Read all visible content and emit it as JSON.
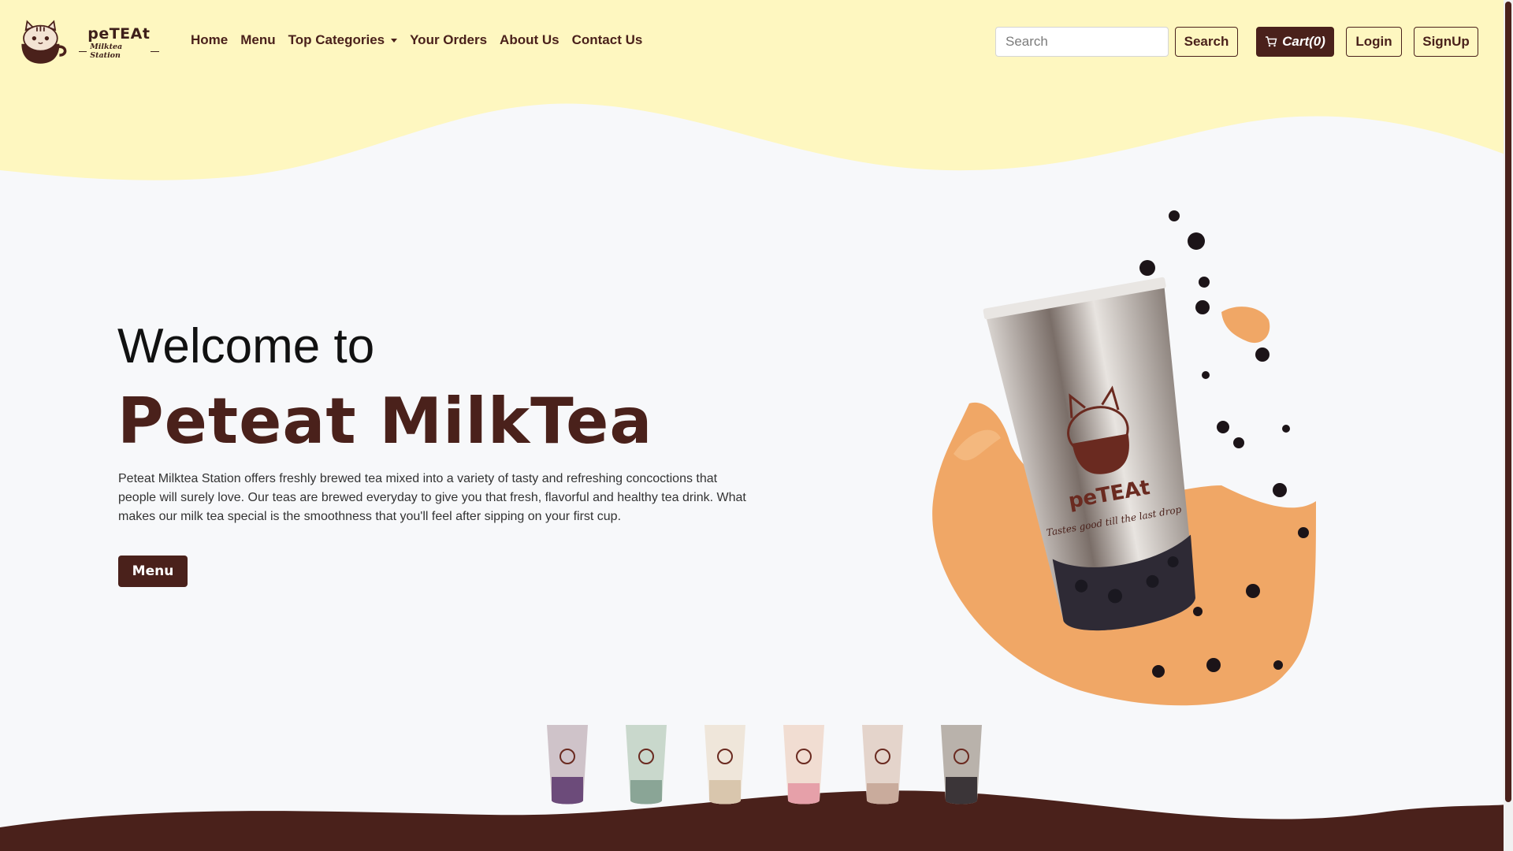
{
  "brand": {
    "name": "peTEAt",
    "subtitle": "Milktea Station"
  },
  "nav": {
    "items": [
      "Home",
      "Menu",
      "Top Categories",
      "Your Orders",
      "About Us",
      "Contact Us"
    ]
  },
  "search": {
    "placeholder": "Search",
    "button_label": "Search"
  },
  "actions": {
    "cart_label": "Cart(0)",
    "login_label": "Login",
    "signup_label": "SignUp"
  },
  "hero": {
    "welcome": "Welcome to",
    "title": "Peteat MilkTea",
    "description": "Peteat Milktea Station offers freshly brewed tea mixed into a variety of tasty and refreshing concoctions that people will surely love. Our teas are brewed everyday to give you that fresh, flavorful and healthy tea drink. What makes our milk tea special is the smoothness that you'll feel after sipping on your first cup.",
    "button_label": "Menu",
    "cup_brand": "peTEAt",
    "cup_tagline": "Tastes good till the last drop"
  },
  "colors": {
    "brand": "#4a211b",
    "cream": "#fef7c0",
    "splash": "#f0a766",
    "page_bg": "#f7f8fa"
  },
  "icons": [
    "cart-icon",
    "caret-down-icon",
    "cat-cup-logo-icon"
  ]
}
